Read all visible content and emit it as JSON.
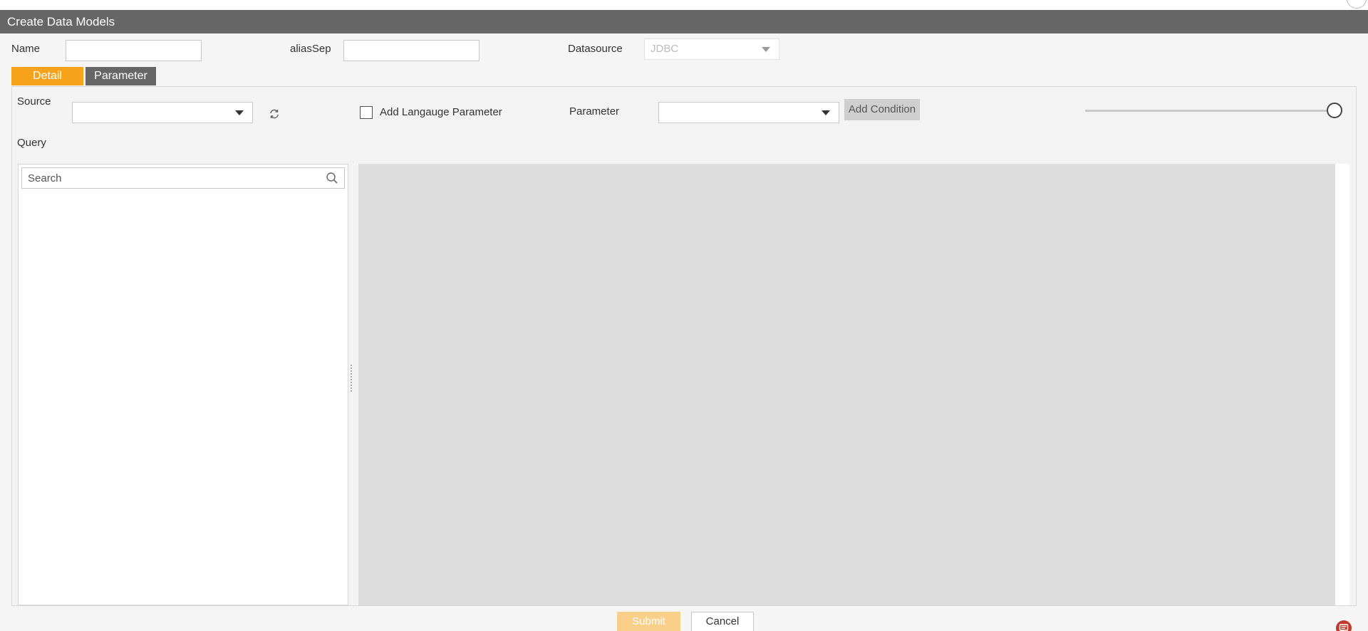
{
  "dialog": {
    "title": "Create Data Models"
  },
  "form": {
    "name_label": "Name",
    "name_value": "",
    "alias_label": "aliasSep",
    "alias_value": "",
    "datasource_label": "Datasource",
    "datasource_value": "JDBC"
  },
  "tabs": [
    {
      "label": "Detail",
      "active": true
    },
    {
      "label": "Parameter",
      "active": false
    }
  ],
  "detail": {
    "source_label": "Source",
    "source_value": "",
    "add_language_label": "Add Langauge Parameter",
    "add_language_checked": false,
    "parameter_label": "Parameter",
    "parameter_value": "",
    "add_condition_label": "Add Condition",
    "slider_level": 1.0,
    "query_label": "Query",
    "search_placeholder": "Search"
  },
  "footer": {
    "submit_label": "Submit",
    "cancel_label": "Cancel"
  },
  "colors": {
    "title_bar": "#666666",
    "active_tab": "#f7a21b",
    "inactive_tab": "#666666",
    "submit_disabled": "#f9cf8a",
    "chat_icon": "#c0392b"
  },
  "icons": {
    "refresh": "refresh-icon",
    "search": "search-icon",
    "chat": "chat-icon"
  }
}
